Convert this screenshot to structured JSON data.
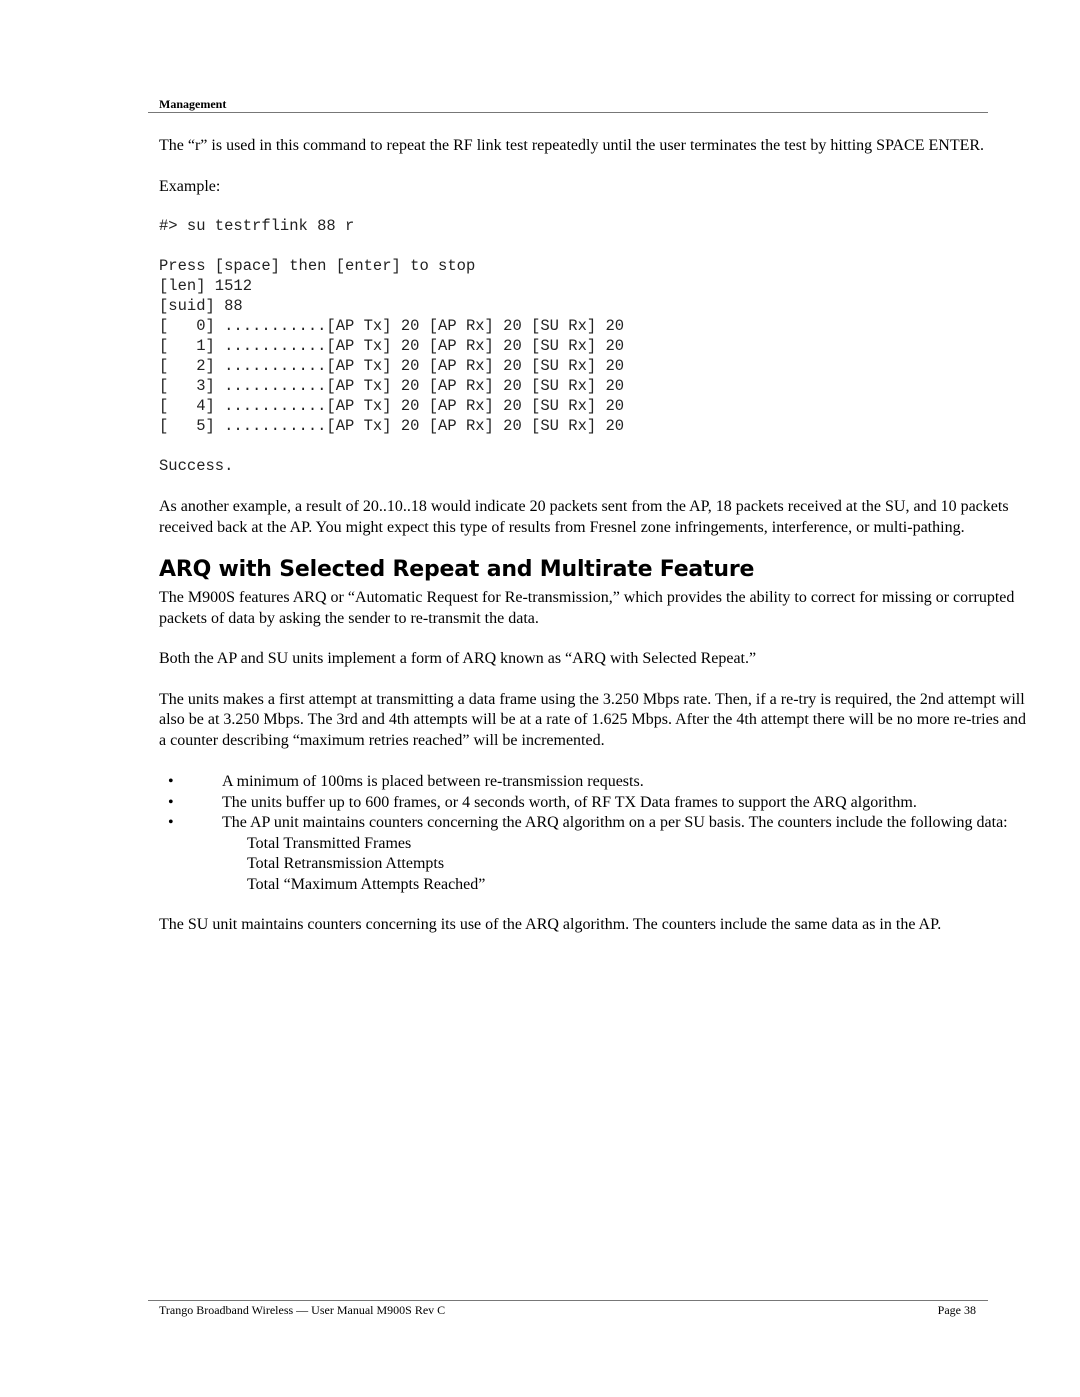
{
  "header": {
    "section_label": "Management"
  },
  "intro": {
    "paragraph": "The “r” is used in this command to repeat the RF link test repeatedly until the user terminates the test by hitting SPACE ENTER.",
    "example_label": "Example:"
  },
  "console": {
    "command": "#> su testrflink 88 r",
    "prompt_line": "Press [space] then [enter] to stop",
    "len_line": "[len] 1512",
    "suid_line": "[suid] 88",
    "result_rows": [
      "[   0] ...........[AP Tx] 20 [AP Rx] 20 [SU Rx] 20",
      "[   1] ...........[AP Tx] 20 [AP Rx] 20 [SU Rx] 20",
      "[   2] ...........[AP Tx] 20 [AP Rx] 20 [SU Rx] 20",
      "[   3] ...........[AP Tx] 20 [AP Rx] 20 [SU Rx] 20",
      "[   4] ...........[AP Tx] 20 [AP Rx] 20 [SU Rx] 20",
      "[   5] ...........[AP Tx] 20 [AP Rx] 20 [SU Rx] 20"
    ],
    "status": "Success."
  },
  "another_example": {
    "paragraph": "As another example, a result of 20..10..18 would indicate 20 packets sent from the AP, 18 packets received at the SU, and 10 packets received back at the AP.  You might expect this type of results from Fresnel zone infringements, interference, or multi-pathing."
  },
  "arq_section": {
    "title": "ARQ with Selected Repeat and Multirate Feature",
    "paragraphs": [
      "The M900S features ARQ or  “Automatic Request for Re-transmission,” which provides the ability to correct for missing or corrupted packets of data by asking the sender to re-transmit the data.",
      "Both the AP and SU units implement a form of ARQ known as “ARQ with Selected Repeat.”",
      "The units makes a first attempt at transmitting a data frame using the 3.250 Mbps rate.  Then, if a re-try is required, the 2nd attempt will also be at 3.250 Mbps.  The 3rd and 4th attempts will be at a rate of 1.625 Mbps.  After the 4th attempt there will be no more re-tries and a counter describing “maximum retries reached” will be incremented."
    ],
    "bullet_glyph": "•",
    "bullets": [
      "A minimum of 100ms is placed between re-transmission requests.",
      "The units buffer up to 600 frames, or 4 seconds worth, of RF TX Data frames to support the ARQ algorithm.",
      "The AP unit maintains counters concerning the ARQ algorithm on a per SU basis.  The counters include the following data:"
    ],
    "counter_items": [
      "Total Transmitted Frames",
      "Total Retransmission Attempts",
      "Total “Maximum Attempts Reached”"
    ],
    "closing_paragraph": "The SU unit maintains counters concerning its use of the ARQ algorithm.  The counters include the same data as in the AP."
  },
  "footer": {
    "left_text": "Trango Broadband Wireless — User Manual M900S Rev C",
    "page_label": "Page 38"
  }
}
